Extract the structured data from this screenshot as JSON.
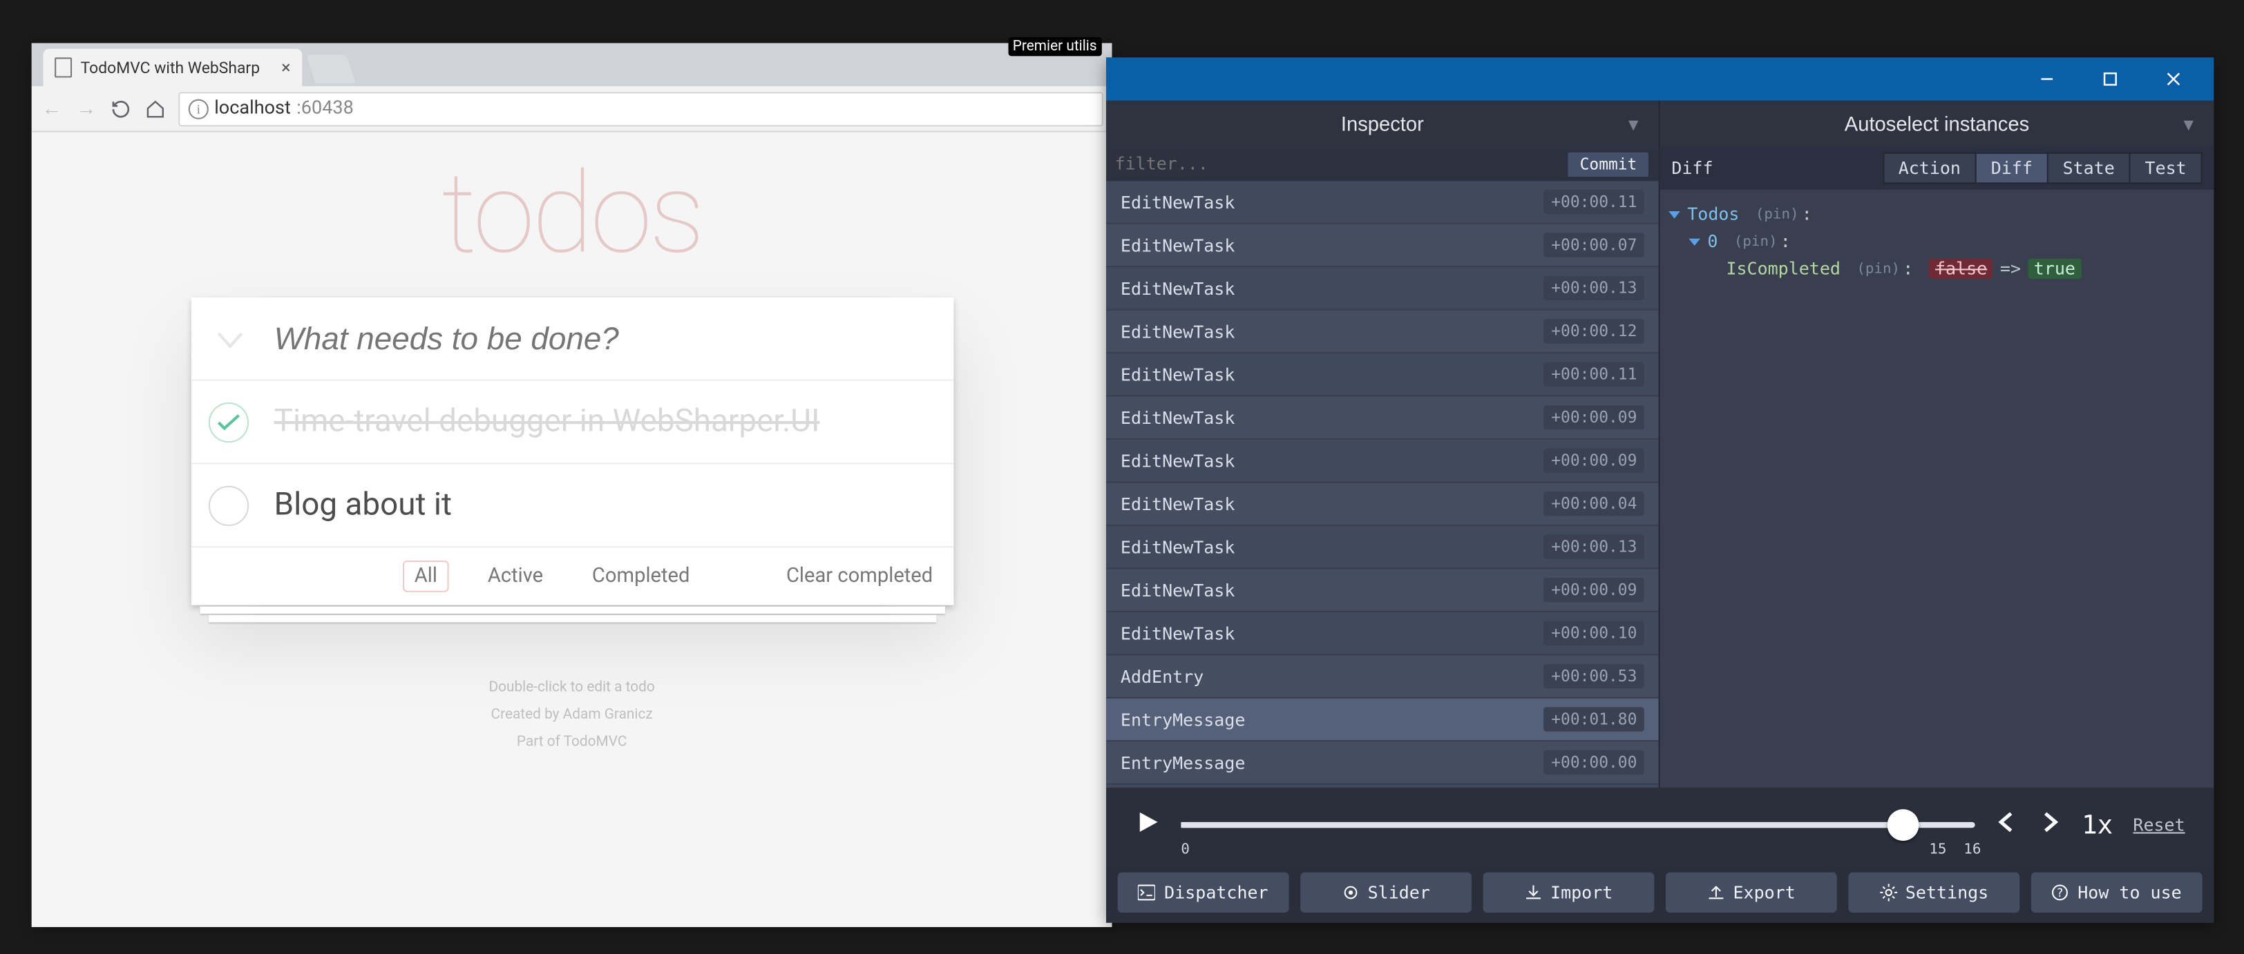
{
  "browser": {
    "tab_title": "TodoMVC with WebSharp",
    "url_host": "localhost",
    "url_port": ":60438"
  },
  "titlebar_hint": "Premier utilis",
  "app": {
    "title": "todos",
    "input_placeholder": "What needs to be done?",
    "items": [
      {
        "label": "Time-travel debugger in WebSharper.UI",
        "done": true
      },
      {
        "label": "Blog about it",
        "done": false
      }
    ],
    "filters": {
      "all": "All",
      "active": "Active",
      "completed": "Completed"
    },
    "clear": "Clear completed",
    "footer": {
      "l1": "Double-click to edit a todo",
      "l2": "Created by Adam Granicz",
      "l3": "Part of TodoMVC"
    }
  },
  "inspector": {
    "left_title": "Inspector",
    "right_title": "Autoselect instances",
    "filter_placeholder": "filter...",
    "commit": "Commit",
    "actions": [
      {
        "name": "EditNewTask",
        "t": "+00:00.11",
        "sel": false
      },
      {
        "name": "EditNewTask",
        "t": "+00:00.07",
        "sel": false
      },
      {
        "name": "EditNewTask",
        "t": "+00:00.13",
        "sel": false
      },
      {
        "name": "EditNewTask",
        "t": "+00:00.12",
        "sel": false
      },
      {
        "name": "EditNewTask",
        "t": "+00:00.11",
        "sel": false
      },
      {
        "name": "EditNewTask",
        "t": "+00:00.09",
        "sel": false
      },
      {
        "name": "EditNewTask",
        "t": "+00:00.09",
        "sel": false
      },
      {
        "name": "EditNewTask",
        "t": "+00:00.04",
        "sel": false
      },
      {
        "name": "EditNewTask",
        "t": "+00:00.13",
        "sel": false
      },
      {
        "name": "EditNewTask",
        "t": "+00:00.09",
        "sel": false
      },
      {
        "name": "EditNewTask",
        "t": "+00:00.10",
        "sel": false
      },
      {
        "name": "AddEntry",
        "t": "+00:00.53",
        "sel": false
      },
      {
        "name": "EntryMessage",
        "t": "+00:01.80",
        "sel": true
      },
      {
        "name": "EntryMessage",
        "t": "+00:00.00",
        "sel": false
      }
    ],
    "diff": {
      "title": "Diff",
      "tabs": {
        "action": "Action",
        "diff": "Diff",
        "state": "State",
        "test": "Test"
      },
      "tree": {
        "root_key": "Todos",
        "pin": "(pin)",
        "idx0": "0",
        "prop": "IsCompleted",
        "old": "false",
        "arrow": "=>",
        "new": "true"
      }
    },
    "playbar": {
      "low": "0",
      "high": "15",
      "cap": "16",
      "speed": "1x",
      "reset": "Reset"
    },
    "toolbar": {
      "dispatcher": "Dispatcher",
      "slider": "Slider",
      "import": "Import",
      "export": "Export",
      "settings": "Settings",
      "how": "How to use"
    }
  }
}
